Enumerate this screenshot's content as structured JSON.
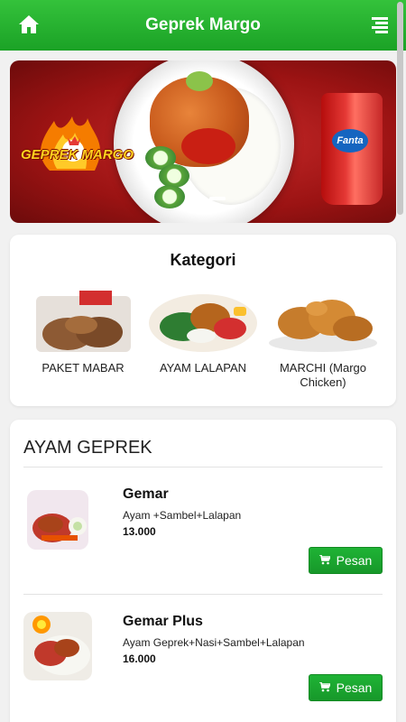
{
  "header": {
    "title": "Geprek Margo",
    "home_icon": "home-icon",
    "menu_icon": "menu-lines-icon"
  },
  "banner": {
    "brand_logo_text": "GEPREK MARGO",
    "drink_logo_text": "Fanta"
  },
  "kategori": {
    "title": "Kategori",
    "items": [
      {
        "label": "PAKET MABAR"
      },
      {
        "label": "AYAM LALAPAN"
      },
      {
        "label": "MARCHI (Margo Chicken)"
      }
    ]
  },
  "menu_section": {
    "title": "AYAM GEPREK",
    "items": [
      {
        "name": "Gemar",
        "description": "Ayam +Sambel+Lalapan",
        "price": "13.000",
        "button_label": "Pesan"
      },
      {
        "name": "Gemar Plus",
        "description": "Ayam Geprek+Nasi+Sambel+Lalapan",
        "price": "16.000",
        "button_label": "Pesan"
      }
    ]
  },
  "colors": {
    "header_green": "#1ba226",
    "button_green": "#17982a",
    "banner_red": "#9b1313"
  }
}
